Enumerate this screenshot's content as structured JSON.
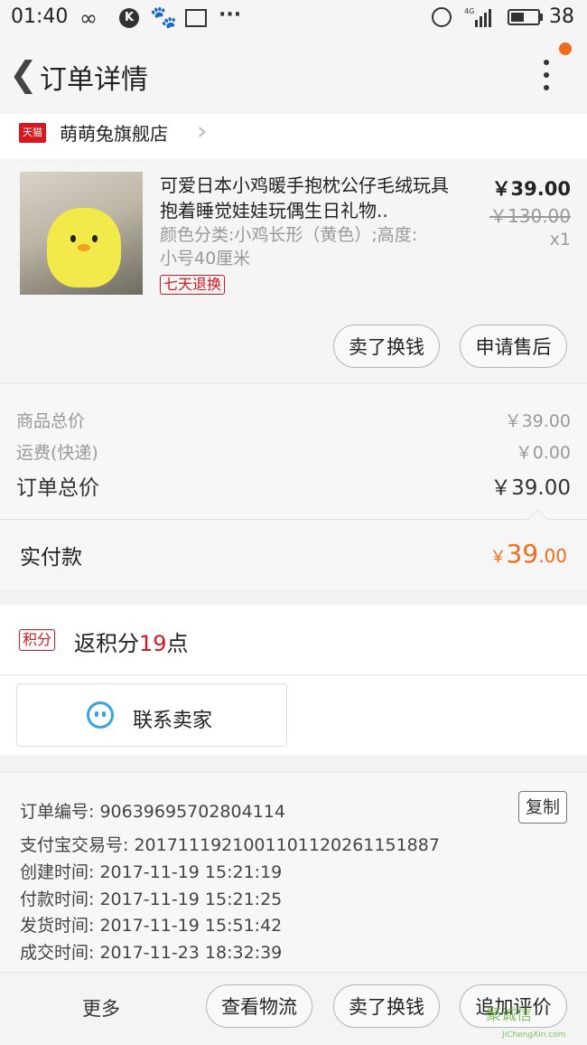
{
  "status_bar": {
    "time": "01:40",
    "battery": "38",
    "icons": [
      "infinity-icon",
      "k-app-icon",
      "paw-icon",
      "image-icon",
      "more-dots-icon",
      "alarm-icon",
      "4g-signal-icon",
      "battery-icon"
    ],
    "battery_level_fraction": 0.45
  },
  "header": {
    "back_icon": "chevron-left-icon",
    "title": "订单详情",
    "menu_icon": "more-vertical-icon",
    "accent": "#f26b1d"
  },
  "shop": {
    "platform_badge": "天猫",
    "name": "萌萌兔旗舰店",
    "accent": "#d7181f"
  },
  "product": {
    "title": "可爱日本小鸡暖手抱枕公仔毛绒玩具抱着睡觉娃娃玩偶生日礼物..",
    "spec": "颜色分类:小鸡长形（黄色）;高度:小号40厘米",
    "return_badge": "七天退换",
    "price": "￥39.00",
    "original_price": "￥130.00",
    "quantity": "x1",
    "btn_sell": "卖了换钱",
    "btn_aftersale": "申请售后"
  },
  "totals": {
    "goods_label": "商品总价",
    "goods_value": "￥39.00",
    "shipping_label": "运费(快递)",
    "shipping_value": "￥0.00",
    "order_label": "订单总价",
    "order_value": "￥39.00"
  },
  "payment": {
    "label": "实付款",
    "currency": "￥",
    "integer": "39",
    "decimal": ".00"
  },
  "points": {
    "badge": "积分",
    "prefix": "返积分",
    "count": "19",
    "suffix": "点"
  },
  "contact": {
    "icon": "chat-bubble-icon",
    "label": "联系卖家",
    "color": "#38a3e0"
  },
  "order_info": {
    "copy_button": "复制",
    "rows": [
      {
        "label": "订单编号:",
        "value": "90639695702804114"
      },
      {
        "label": "支付宝交易号:",
        "value": "2017111921001101120261151887"
      },
      {
        "label": "创建时间:",
        "value": "2017-11-19 15:21:19"
      },
      {
        "label": "付款时间:",
        "value": "2017-11-19 15:21:25"
      },
      {
        "label": "发货时间:",
        "value": "2017-11-19 15:51:42"
      },
      {
        "label": "成交时间:",
        "value": "2017-11-23 18:32:39"
      }
    ]
  },
  "bottom_bar": {
    "more": "更多",
    "logistics": "查看物流",
    "sell": "卖了换钱",
    "review": "追加评价"
  },
  "watermark": {
    "text": "聚诚信",
    "url": "JiChengXin.com"
  }
}
